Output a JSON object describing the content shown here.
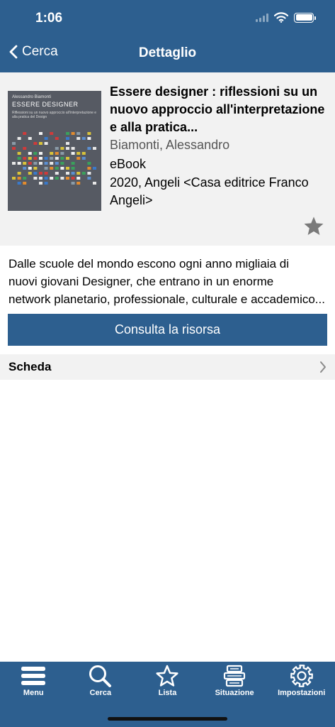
{
  "status_bar": {
    "time": "1:06"
  },
  "nav": {
    "back_label": "Cerca",
    "title": "Dettaglio"
  },
  "book": {
    "cover": {
      "author": "Alessandro Biamonti",
      "title": "ESSERE DESIGNER",
      "subtitle": "Riflessioni su un nuovo approccio all'interpretazione e alla pratica del Design"
    },
    "title": "Essere designer : riflessioni su un nuovo approccio all'interpretazione e alla pratica...",
    "author": "Biamonti, Alessandro",
    "format": "eBook",
    "publication": "2020, Angeli <Casa editrice Franco Angeli>"
  },
  "summary": {
    "line1": "Dalle scuole del mondo escono ogni anno migliaia di",
    "line2": "nuovi giovani Designer, che entrano in un enorme",
    "line3": "network planetario, professionale, culturale e accademico..."
  },
  "consult_button": "Consulta la risorsa",
  "scheda_label": "Scheda",
  "tabs": [
    {
      "label": "Menu",
      "icon": "menu-icon"
    },
    {
      "label": "Cerca",
      "icon": "search-icon"
    },
    {
      "label": "Lista",
      "icon": "star-icon"
    },
    {
      "label": "Situazione",
      "icon": "books-stack-icon"
    },
    {
      "label": "Impostazioni",
      "icon": "gear-icon"
    }
  ],
  "colors": {
    "primary": "#2d5f8f",
    "card_bg": "#f2f2f2",
    "star": "#7a7a7a"
  }
}
